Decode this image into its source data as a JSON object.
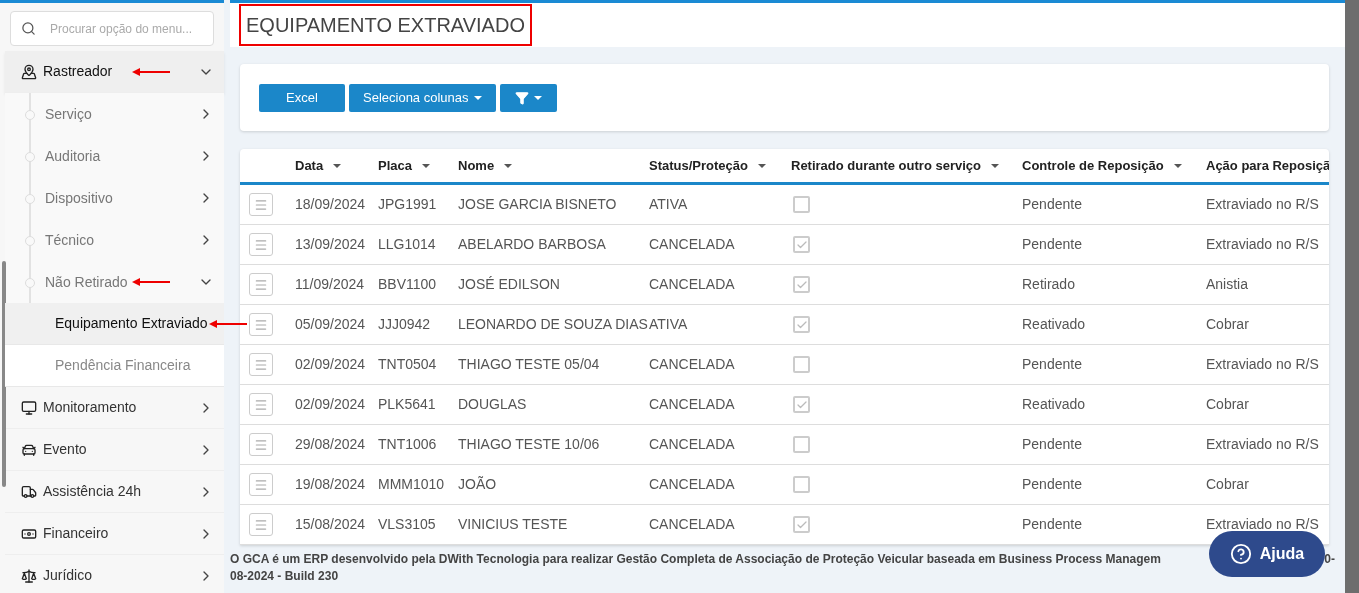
{
  "sidebar": {
    "search": {
      "placeholder": "Procurar opção do menu..."
    },
    "items": [
      {
        "label": "Rastreador",
        "selected": true,
        "expanded": true,
        "marked": true,
        "children": [
          {
            "label": "Serviço",
            "expanded": false,
            "marked": false
          },
          {
            "label": "Auditoria",
            "expanded": false,
            "marked": false
          },
          {
            "label": "Dispositivo",
            "expanded": false,
            "marked": false
          },
          {
            "label": "Técnico",
            "expanded": false,
            "marked": false
          },
          {
            "label": "Não Retirado",
            "expanded": true,
            "marked": true,
            "children": [
              {
                "label": "Equipamento Extraviado",
                "selected": true,
                "marked": true
              },
              {
                "label": "Pendência Financeira",
                "selected": false,
                "marked": false
              }
            ]
          }
        ]
      },
      {
        "label": "Monitoramento",
        "selected": false,
        "expanded": false,
        "marked": false
      },
      {
        "label": "Evento",
        "selected": false,
        "expanded": false,
        "marked": false
      },
      {
        "label": "Assistência 24h",
        "selected": false,
        "expanded": false,
        "marked": false
      },
      {
        "label": "Financeiro",
        "selected": false,
        "expanded": false,
        "marked": false
      },
      {
        "label": "Jurídico",
        "selected": false,
        "expanded": false,
        "marked": false
      }
    ]
  },
  "page": {
    "title": "EQUIPAMENTO EXTRAVIADO",
    "marked": true
  },
  "toolbar": {
    "buttons": [
      {
        "kind": "plain",
        "label": "Excel"
      },
      {
        "kind": "dropdown",
        "label": "Seleciona colunas"
      },
      {
        "kind": "filter"
      }
    ]
  },
  "table": {
    "columns": [
      "Data",
      "Placa",
      "Nome",
      "Status/Proteção",
      "Retirado durante outro serviço",
      "Controle de Reposição",
      "Ação para Reposiçã"
    ],
    "rows": [
      {
        "data": "18/09/2024",
        "placa": "JPG1991",
        "nome": "JOSE GARCIA BISNETO",
        "status": "ATIVA",
        "retirado": false,
        "controle": "Pendente",
        "acao": "Extraviado no R/S"
      },
      {
        "data": "13/09/2024",
        "placa": "LLG1014",
        "nome": "ABELARDO BARBOSA",
        "status": "CANCELADA",
        "retirado": true,
        "controle": "Pendente",
        "acao": "Extraviado no R/S"
      },
      {
        "data": "11/09/2024",
        "placa": "BBV1100",
        "nome": "JOSÉ EDILSON",
        "status": "CANCELADA",
        "retirado": true,
        "controle": "Retirado",
        "acao": "Anistia"
      },
      {
        "data": "05/09/2024",
        "placa": "JJJ0942",
        "nome": "LEONARDO DE SOUZA DIAS",
        "status": "ATIVA",
        "retirado": true,
        "controle": "Reativado",
        "acao": "Cobrar"
      },
      {
        "data": "02/09/2024",
        "placa": "TNT0504",
        "nome": "THIAGO TESTE 05/04",
        "status": "CANCELADA",
        "retirado": false,
        "controle": "Pendente",
        "acao": "Extraviado no R/S"
      },
      {
        "data": "02/09/2024",
        "placa": "PLK5641",
        "nome": "DOUGLAS",
        "status": "CANCELADA",
        "retirado": true,
        "controle": "Reativado",
        "acao": "Cobrar"
      },
      {
        "data": "29/08/2024",
        "placa": "TNT1006",
        "nome": "THIAGO TESTE 10/06",
        "status": "CANCELADA",
        "retirado": false,
        "controle": "Pendente",
        "acao": "Extraviado no R/S"
      },
      {
        "data": "19/08/2024",
        "placa": "MMM1010",
        "nome": "JOÃO",
        "status": "CANCELADA",
        "retirado": false,
        "controle": "Pendente",
        "acao": "Cobrar"
      },
      {
        "data": "15/08/2024",
        "placa": "VLS3105",
        "nome": "VINICIUS TESTE",
        "status": "CANCELADA",
        "retirado": true,
        "controle": "Pendente",
        "acao": "Extraviado no R/S"
      }
    ]
  },
  "footer": {
    "line_1": "O GCA é um ERP desenvolvido pela DWith Tecnologia para realizar Gestão Completa de Associação de Proteção Veicular baseada em Business Process Managem",
    "line_1_end": "0-",
    "line_2": "08-2024 - Build 230"
  },
  "help_button": {
    "label": "Ajuda"
  }
}
